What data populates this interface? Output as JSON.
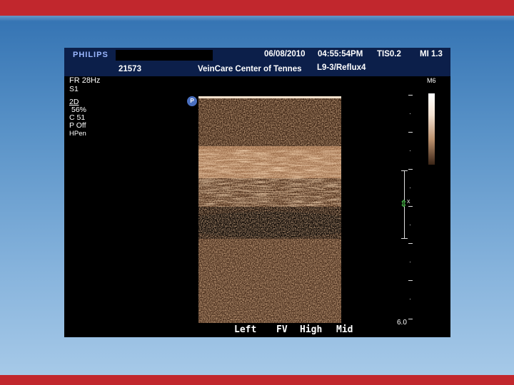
{
  "header": {
    "brand": "PHILIPS",
    "date": "06/08/2010",
    "time": "04:55:54PM",
    "tis": "TIS0.2",
    "mi": "MI 1.3",
    "patient_id": "21573",
    "center": "VeinCare Center of Tennes",
    "probe_preset": "L9-3/Reflux4"
  },
  "params": {
    "fr": "FR 28Hz",
    "s1": "S1",
    "mode": "2D",
    "gain": "56%",
    "c": "C 51",
    "p": "P Off",
    "hpen": "HPen"
  },
  "grayscale_label": "M6",
  "probe_marker": "P",
  "depth_readout": "6.0",
  "gate_label": "x",
  "bottom": {
    "side": "Left",
    "vessel": "FV",
    "level": "High",
    "position": "Mid"
  },
  "colors": {
    "top_bar": "#c1272d",
    "header_bg": "#0c1f4a",
    "tissue": "#c88a5a",
    "gate_arrow": "#3c9a3c"
  }
}
